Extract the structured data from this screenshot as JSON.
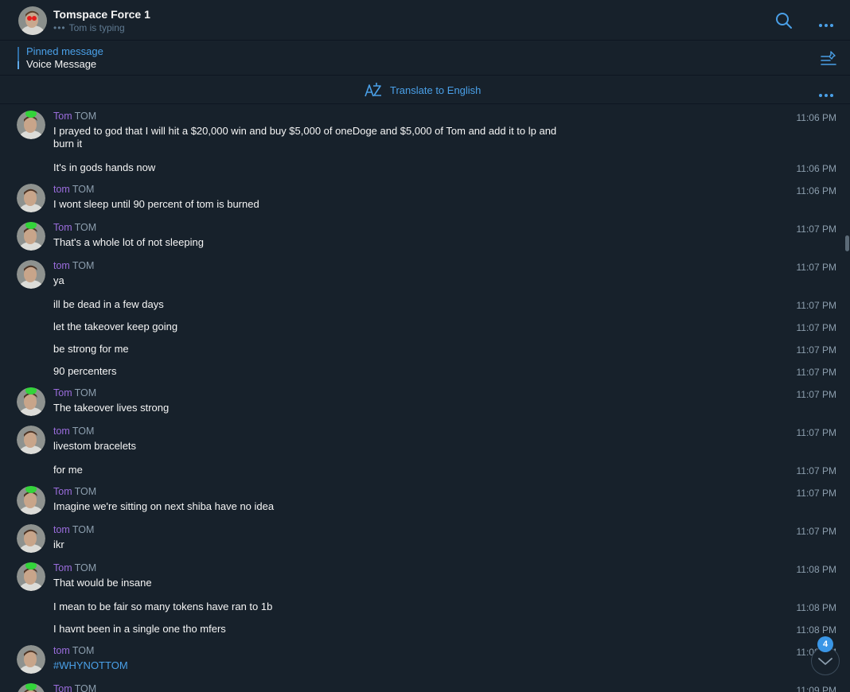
{
  "header": {
    "title": "Tomspace Force 1",
    "status": "Tom is typing",
    "typing_dots": "•••"
  },
  "pinned": {
    "label": "Pinned message",
    "value": "Voice Message"
  },
  "translate": {
    "label": "Translate to English"
  },
  "colors": {
    "background": "#17212b",
    "accent": "#4aa0e8",
    "sender": "#9b6ddd",
    "time": "#8c9eae"
  },
  "icons": {
    "search": "search-icon",
    "more": "more-icon",
    "pinned_list": "pinned-list-icon",
    "translate": "translate-icon",
    "scroll_down": "chevron-down-icon"
  },
  "messages": [
    {
      "name": "Tom",
      "tag": "TOM",
      "avatar": "green",
      "text": "I prayed to god that I will hit a $20,000 win and buy $5,000 of oneDoge and $5,000 of Tom and add it to lp and burn it",
      "time": "11:06 PM"
    },
    {
      "text": "It's in gods hands now",
      "time": "11:06 PM"
    },
    {
      "name": "tom",
      "tag": "TOM",
      "avatar": "plain",
      "text": "I wont sleep until 90 percent of tom is burned",
      "time": "11:06 PM"
    },
    {
      "name": "Tom",
      "tag": "TOM",
      "avatar": "green",
      "text": "That's a whole lot of not sleeping",
      "time": "11:07 PM"
    },
    {
      "name": "tom",
      "tag": "TOM",
      "avatar": "plain",
      "text": "ya",
      "time": "11:07 PM"
    },
    {
      "text": "ill be dead in a few days",
      "time": "11:07 PM"
    },
    {
      "text": "let the takeover keep going",
      "time": "11:07 PM"
    },
    {
      "text": "be strong for me",
      "time": "11:07 PM"
    },
    {
      "text": "90 percenters",
      "time": "11:07 PM"
    },
    {
      "name": "Tom",
      "tag": "TOM",
      "avatar": "green",
      "text": "The takeover lives strong",
      "time": "11:07 PM"
    },
    {
      "name": "tom",
      "tag": "TOM",
      "avatar": "plain",
      "text": "livestom bracelets",
      "time": "11:07 PM"
    },
    {
      "text": "for me",
      "time": "11:07 PM"
    },
    {
      "name": "Tom",
      "tag": "TOM",
      "avatar": "green",
      "text": "Imagine we're sitting on next shiba have no idea",
      "time": "11:07 PM"
    },
    {
      "name": "tom",
      "tag": "TOM",
      "avatar": "plain",
      "text": "ikr",
      "time": "11:07 PM"
    },
    {
      "name": "Tom",
      "tag": "TOM",
      "avatar": "green",
      "text": "That would be insane",
      "time": "11:08 PM"
    },
    {
      "text": "I mean to be fair so many tokens have ran to 1b",
      "time": "11:08 PM"
    },
    {
      "text": "I havnt been in a single one tho mfers",
      "time": "11:08 PM"
    },
    {
      "name": "tom",
      "tag": "TOM",
      "avatar": "plain",
      "text": "#WHYNOTTOM",
      "link": true,
      "time": "11:08 PM"
    },
    {
      "name": "Tom",
      "tag": "TOM",
      "avatar": "green",
      "text": "",
      "time": "11:09 PM"
    }
  ],
  "unread_count": "4"
}
